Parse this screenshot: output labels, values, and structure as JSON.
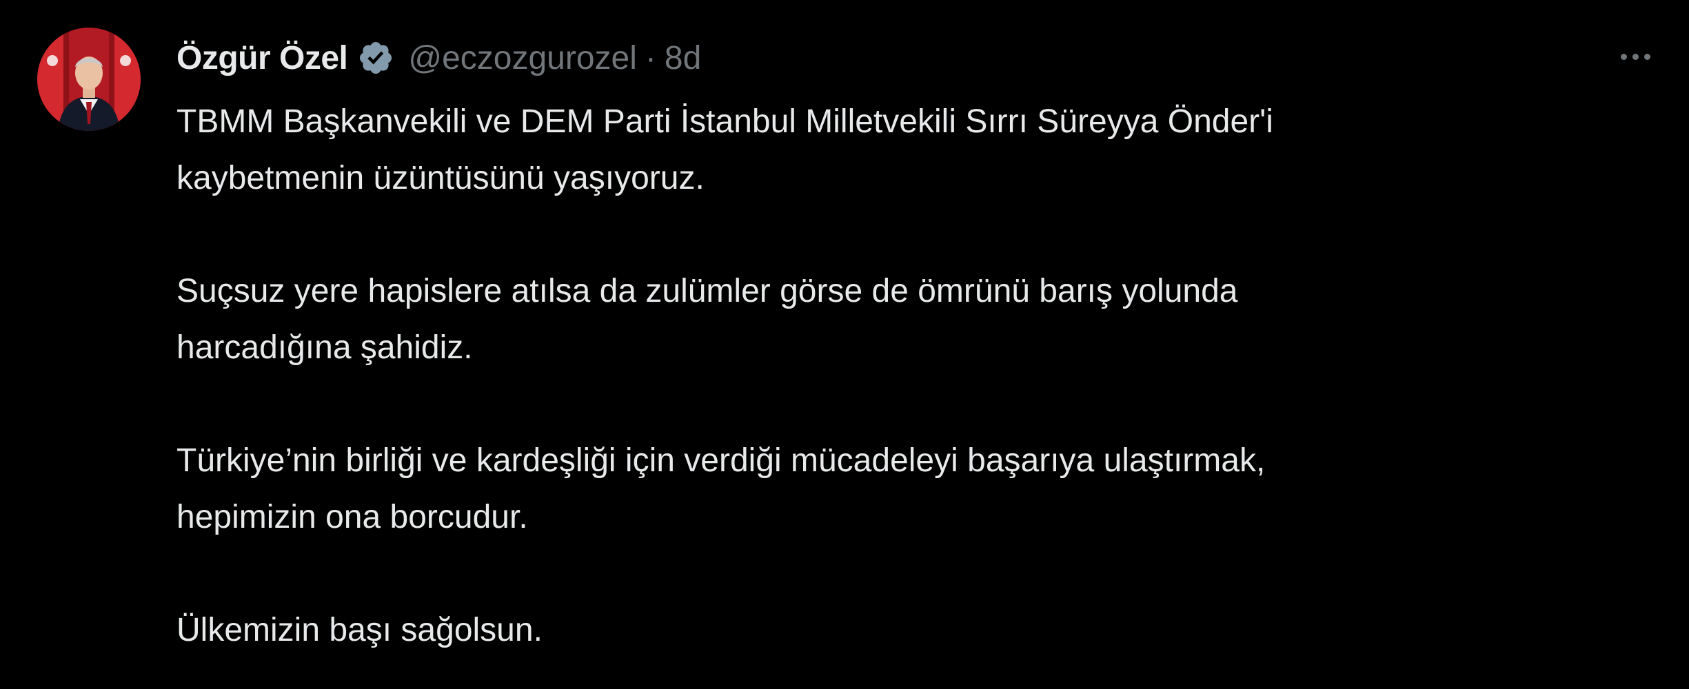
{
  "tweet": {
    "author": {
      "display_name": "Özgür Özel",
      "handle": "@eczozgurozel",
      "verified_icon": "verified-badge-icon",
      "avatar_icon": "profile-photo"
    },
    "separator": "·",
    "timestamp": "8d",
    "more_icon": "more-options-icon",
    "paragraphs": [
      {
        "lines": [
          "TBMM Başkanvekili ve DEM Parti İstanbul Milletvekili Sırrı Süreyya Önder'i",
          "kaybetmenin üzüntüsünü yaşıyoruz."
        ]
      },
      {
        "lines": [
          "Suçsuz yere hapislere atılsa da zulümler görse de ömrünü barış yolunda",
          "harcadığına şahidiz."
        ]
      },
      {
        "lines": [
          "Türkiye’nin birliği ve kardeşliği için verdiği mücadeleyi başarıya ulaştırmak,",
          "hepimizin ona borcudur."
        ]
      },
      {
        "lines": [
          "Ülkemizin başı sağolsun."
        ]
      }
    ]
  },
  "colors": {
    "background": "#000000",
    "text_primary": "#e7e9ea",
    "text_secondary": "#71767b",
    "verified_badge": "#829aab",
    "avatar_red": "#c8102e"
  }
}
